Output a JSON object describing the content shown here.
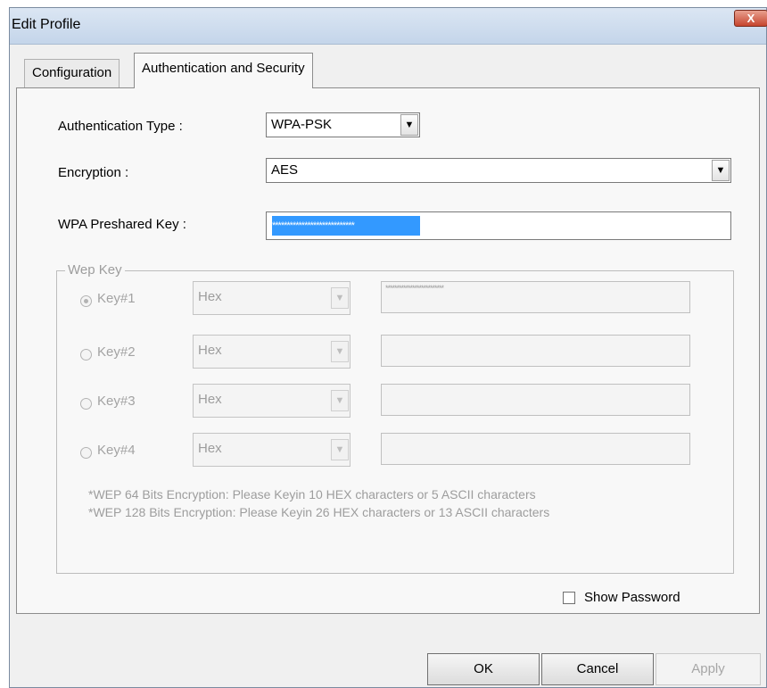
{
  "window": {
    "title": "Edit Profile",
    "close_label": "X"
  },
  "tabs": [
    {
      "label": "Configuration",
      "selected": false
    },
    {
      "label": "Authentication and Security",
      "selected": true
    }
  ],
  "form": {
    "auth_type_label": "Authentication Type :",
    "auth_type_value": "WPA-PSK",
    "encryption_label": "Encryption :",
    "encryption_value": "AES",
    "preshared_label": "WPA Preshared Key :",
    "preshared_value": "****************************"
  },
  "wep": {
    "group_title": "Wep Key",
    "keys": [
      {
        "label": "Key#1",
        "format": "Hex",
        "value": "**************************",
        "selected": true
      },
      {
        "label": "Key#2",
        "format": "Hex",
        "value": "",
        "selected": false
      },
      {
        "label": "Key#3",
        "format": "Hex",
        "value": "",
        "selected": false
      },
      {
        "label": "Key#4",
        "format": "Hex",
        "value": "",
        "selected": false
      }
    ],
    "note_64": "*WEP 64 Bits Encryption:  Please Keyin 10 HEX characters or 5 ASCII characters",
    "note_128": "*WEP 128 Bits Encryption:  Please Keyin 26 HEX characters or 13 ASCII characters"
  },
  "show_password_label": "Show Password",
  "buttons": {
    "ok": "OK",
    "cancel": "Cancel",
    "apply": "Apply"
  },
  "icons": {
    "dropdown": "chevron-down-icon",
    "close": "close-icon"
  },
  "colors": {
    "selection": "#3399ff",
    "titlebar": "#c4d5ea",
    "close": "#c6452e"
  }
}
